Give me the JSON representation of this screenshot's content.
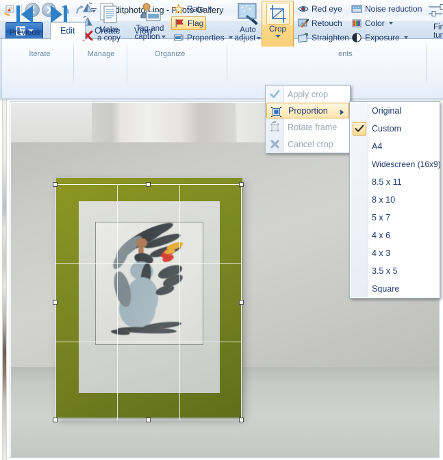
{
  "window": {
    "title": "editphoto3.jpg - Photo Gallery",
    "app_icon": "photo-gallery-icon",
    "quick_access": [
      {
        "name": "back-button",
        "icon": "arrow-left-icon"
      },
      {
        "name": "forward-button",
        "icon": "arrow-right-icon"
      },
      {
        "name": "undo-button",
        "icon": "undo-arrow-icon"
      },
      {
        "name": "redo-button",
        "icon": "redo-arrow-icon"
      },
      {
        "name": "customize-quick-access-button",
        "icon": "chevron-down-icon"
      }
    ]
  },
  "tabs": {
    "app_menu_label": "",
    "items": [
      {
        "label": "Edit",
        "active": true
      },
      {
        "label": "Create",
        "active": false
      },
      {
        "label": "View",
        "active": false
      }
    ]
  },
  "ribbon": {
    "groups": [
      {
        "label": "Iterate",
        "buttons": [
          {
            "label": "Previous",
            "icon": "previous-icon"
          },
          {
            "label": "Next",
            "icon": "next-icon"
          }
        ]
      },
      {
        "label": "Manage",
        "buttons": [
          {
            "label": "Make\na copy",
            "label_line1": "Make",
            "label_line2": "a copy",
            "icon": "copy-icon"
          }
        ],
        "small_icons": [
          {
            "name": "rotate-left-icon"
          },
          {
            "name": "rotate-right-icon"
          },
          {
            "name": "delete-icon"
          }
        ]
      },
      {
        "label": "Organize",
        "buttons": [
          {
            "label_line1": "Tag and",
            "label_line2": "caption",
            "icon": "tag-caption-icon",
            "has_caret": true
          }
        ],
        "items": [
          {
            "label": "Rate",
            "icon": "star-icon",
            "has_caret": true,
            "highlighted": false
          },
          {
            "label": "Flag",
            "icon": "flag-icon",
            "has_caret": false,
            "highlighted": true
          },
          {
            "label": "Properties",
            "icon": "properties-icon",
            "has_caret": true,
            "highlighted": false
          }
        ]
      },
      {
        "label": "Adjustments",
        "label_visible": "ents",
        "buttons": [
          {
            "label_line1": "Auto",
            "label_line2": "adjust",
            "icon": "auto-adjust-icon",
            "has_caret": true
          },
          {
            "label": "Crop",
            "icon": "crop-icon",
            "has_caret": true,
            "active": true
          }
        ],
        "items": [
          {
            "label": "Red eye",
            "icon": "red-eye-icon",
            "has_caret": false
          },
          {
            "label": "Retouch",
            "icon": "retouch-icon",
            "has_caret": false
          },
          {
            "label": "Straighten",
            "icon": "straighten-icon",
            "has_caret": false
          },
          {
            "label": "Noise reduction",
            "icon": "noise-reduction-icon",
            "has_caret": false
          },
          {
            "label": "Color",
            "icon": "color-icon",
            "has_caret": true
          },
          {
            "label": "Exposure",
            "icon": "exposure-icon",
            "has_caret": true
          }
        ]
      },
      {
        "label": "",
        "buttons": [
          {
            "label_line1": "Fin",
            "label_line2": "tun",
            "icon": "fine-tune-icon",
            "clipped": true
          }
        ]
      }
    ]
  },
  "crop_menu": {
    "items": [
      {
        "label": "Apply crop",
        "icon": "checkmark-icon",
        "disabled": true,
        "selected": false,
        "submenu": false
      },
      {
        "label": "Proportion",
        "icon": "proportion-icon",
        "disabled": false,
        "selected": true,
        "submenu": true
      },
      {
        "label": "Rotate frame",
        "icon": "rotate-frame-icon",
        "disabled": true,
        "selected": false,
        "submenu": false
      },
      {
        "label": "Cancel crop",
        "icon": "cancel-crop-icon",
        "disabled": true,
        "selected": false,
        "submenu": false
      }
    ]
  },
  "proportion_menu": {
    "items": [
      {
        "label": "Original",
        "checked": false
      },
      {
        "label": "Custom",
        "checked": true
      },
      {
        "label": "A4",
        "checked": false
      },
      {
        "label": "Widescreen (16x9)",
        "checked": false
      },
      {
        "label": "8.5 x 11",
        "checked": false
      },
      {
        "label": "8 x 10",
        "checked": false
      },
      {
        "label": "5 x 7",
        "checked": false
      },
      {
        "label": "4 x 6",
        "checked": false
      },
      {
        "label": "4 x 3",
        "checked": false
      },
      {
        "label": "3.5 x 5",
        "checked": false
      },
      {
        "label": "Square",
        "checked": false
      }
    ]
  },
  "photo": {
    "name": "editphoto3.jpg",
    "description": "Framed watercolor sketch of a woman in a long gown, olive-green picture frame on a light wall",
    "crop_overlay": {
      "grid": "rule-of-thirds",
      "handles": 8
    }
  },
  "colors": {
    "accent_orange": "#e0a23c",
    "highlight_fill": "#ffe6ae",
    "tab_blue": "#15457e",
    "frame_green": "#7d8d23",
    "menu_bg": "#ffffff"
  }
}
